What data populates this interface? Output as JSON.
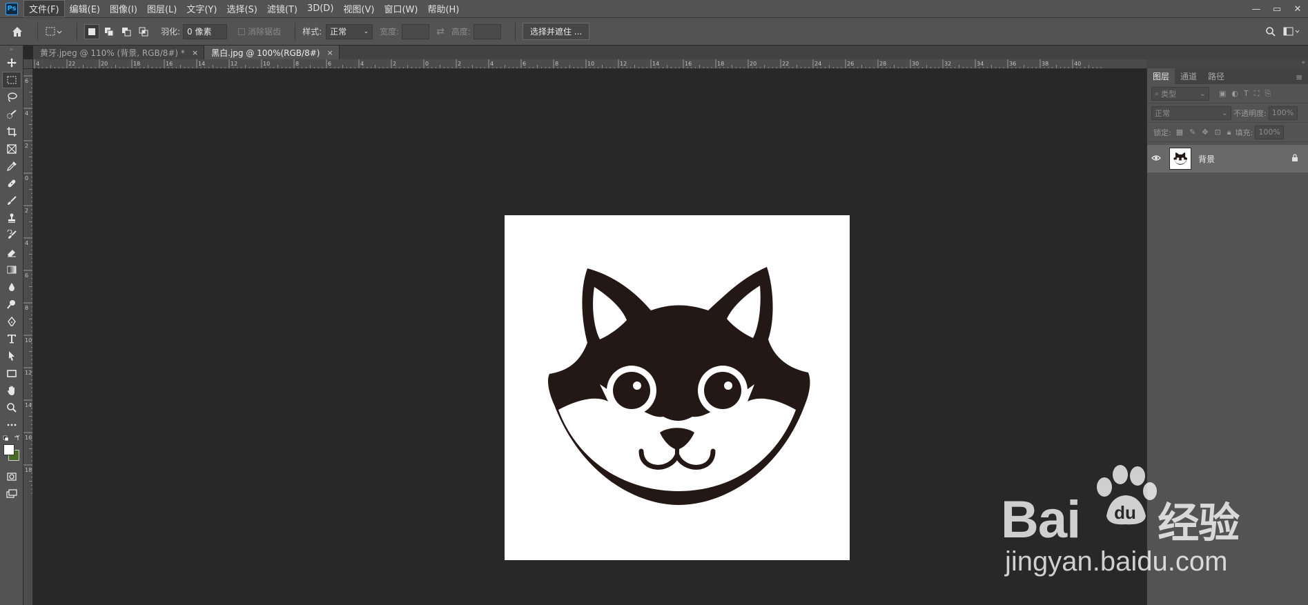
{
  "menubar": {
    "logo": "Ps",
    "items": [
      "文件(F)",
      "编辑(E)",
      "图像(I)",
      "图层(L)",
      "文字(Y)",
      "选择(S)",
      "滤镜(T)",
      "3D(D)",
      "视图(V)",
      "窗口(W)",
      "帮助(H)"
    ],
    "window_controls": [
      "—",
      "▭",
      "✕"
    ]
  },
  "options": {
    "feather_label": "羽化:",
    "feather_value": "0 像素",
    "antialias_label": "消除锯齿",
    "style_label": "样式:",
    "style_value": "正常",
    "width_label": "宽度:",
    "height_label": "高度:",
    "swap_icon": "⇄",
    "select_mask_label": "选择并遮住 ..."
  },
  "tabs": [
    {
      "label": "黄牙.jpeg @ 110% (背景, RGB/8#) *",
      "close": "×"
    },
    {
      "label": "黑白.jpg @ 100%(RGB/8#)",
      "close": "×"
    }
  ],
  "rulers": {
    "top_ticks": [
      "4",
      "22",
      "20",
      "18",
      "16",
      "14",
      "12",
      "10",
      "8",
      "6",
      "4",
      "2",
      "0",
      "2",
      "4",
      "6",
      "8",
      "10",
      "12",
      "14",
      "16",
      "18",
      "20",
      "22",
      "24",
      "26",
      "28",
      "30",
      "32",
      "34",
      "36",
      "38",
      "40"
    ],
    "left_ticks": [
      "6",
      "4",
      "2",
      "0",
      "2",
      "4",
      "6",
      "8",
      "1 0",
      "1 2",
      "1 4",
      "1 6",
      "1 8"
    ]
  },
  "panel": {
    "tabs": [
      "图层",
      "通道",
      "路径"
    ],
    "filter_placeholder": "类型",
    "blend_mode": "正常",
    "opacity_label": "不透明度:",
    "opacity_value": "100%",
    "lock_label": "锁定:",
    "fill_label": "填充:",
    "fill_value": "100%",
    "layer_name": "背景"
  },
  "watermark": {
    "brand": "Bai",
    "brand_cn": "经验",
    "url": "jingyan.baidu.com"
  },
  "colors": {
    "chrome": "#535353",
    "canvas_bg": "#282828",
    "fox": "#231815",
    "bg_color_swatch": "#4a6a28"
  }
}
